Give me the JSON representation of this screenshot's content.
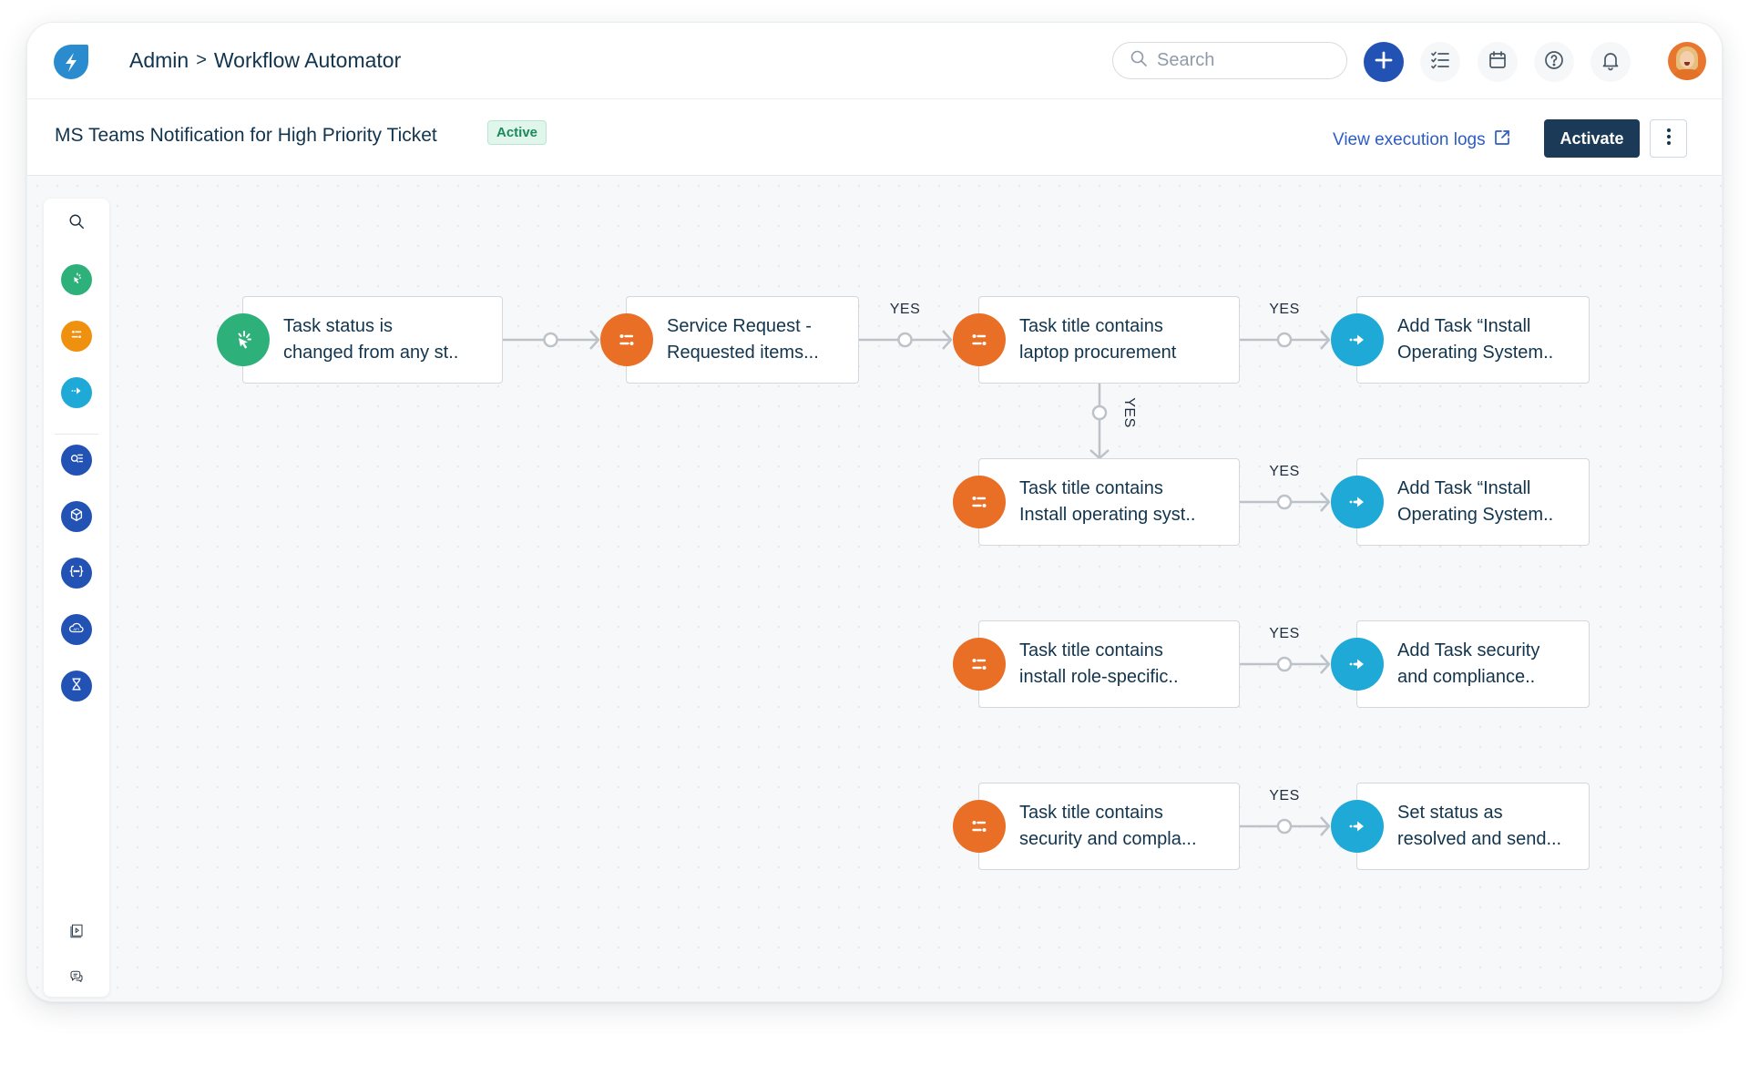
{
  "header": {
    "logo_icon": "lightning-bolt-icon",
    "breadcrumb": [
      "Admin",
      "Workflow Automator"
    ],
    "breadcrumb_separator": ">",
    "search": {
      "placeholder": "Search",
      "value": ""
    },
    "actions": [
      {
        "name": "new-item-button",
        "icon": "plus-icon"
      },
      {
        "name": "todo-button",
        "icon": "checklist-icon"
      },
      {
        "name": "calendar-button",
        "icon": "calendar-icon"
      },
      {
        "name": "help-button",
        "icon": "help-icon"
      },
      {
        "name": "notifications-button",
        "icon": "bell-icon"
      }
    ],
    "avatar": "user-avatar"
  },
  "workflow": {
    "title": "MS Teams Notification for High Priority Ticket",
    "status": "Active",
    "execution_logs_label": "View execution logs",
    "activate_label": "Activate"
  },
  "palette": {
    "top": [
      {
        "name": "search",
        "icon": "search-icon",
        "color": ""
      },
      {
        "name": "event",
        "icon": "cursor-click-icon",
        "color": "#2db07a"
      },
      {
        "name": "condition",
        "icon": "sliders-icon",
        "color": "#f0900f"
      },
      {
        "name": "action",
        "icon": "arrow-right-icon",
        "color": "#1ea9d6"
      }
    ],
    "middle": [
      {
        "name": "lookup",
        "icon": "search-list-icon",
        "color": "#2352b5"
      },
      {
        "name": "app",
        "icon": "cube-icon",
        "color": "#2352b5"
      },
      {
        "name": "json-parser",
        "icon": "braces-icon",
        "color": "#2352b5"
      },
      {
        "name": "web-request",
        "icon": "cloud-api-icon",
        "color": "#2352b5"
      },
      {
        "name": "timer",
        "icon": "hourglass-icon",
        "color": "#2352b5"
      }
    ],
    "bottom": [
      {
        "name": "tutorial",
        "icon": "video-book-icon"
      },
      {
        "name": "feedback",
        "icon": "chat-bubbles-icon"
      }
    ]
  },
  "flow": {
    "colors": {
      "trigger": "#2db07a",
      "condition": "#e86f25",
      "action": "#1ea9d6"
    },
    "edge_label": "YES",
    "nodes": [
      {
        "id": "n1",
        "type": "trigger",
        "text": [
          "Task status is",
          "changed from any st.."
        ]
      },
      {
        "id": "n2",
        "type": "condition",
        "text": [
          "Service Request -",
          "Requested items..."
        ]
      },
      {
        "id": "n3",
        "type": "condition",
        "text": [
          "Task title contains",
          "laptop procurement"
        ]
      },
      {
        "id": "n4",
        "type": "action",
        "text": [
          "Add Task “Install",
          "Operating System.."
        ]
      },
      {
        "id": "n5",
        "type": "condition",
        "text": [
          "Task title contains",
          "Install operating syst.."
        ]
      },
      {
        "id": "n6",
        "type": "action",
        "text": [
          "Add Task “Install",
          "Operating System.."
        ]
      },
      {
        "id": "n7",
        "type": "condition",
        "text": [
          "Task title contains",
          "install role-specific.."
        ]
      },
      {
        "id": "n8",
        "type": "action",
        "text": [
          "Add Task security",
          "and compliance.."
        ]
      },
      {
        "id": "n9",
        "type": "condition",
        "text": [
          "Task title contains",
          "security and compla..."
        ]
      },
      {
        "id": "n10",
        "type": "action",
        "text": [
          "Set status as",
          "resolved and send..."
        ]
      }
    ],
    "edges": [
      {
        "from": "n1",
        "to": "n2",
        "label": ""
      },
      {
        "from": "n2",
        "to": "n3",
        "label": "YES"
      },
      {
        "from": "n3",
        "to": "n4",
        "label": "YES"
      },
      {
        "from": "n3",
        "to": "n5",
        "label": "YES"
      },
      {
        "from": "n5",
        "to": "n6",
        "label": "YES"
      },
      {
        "from": "n7",
        "to": "n8",
        "label": "YES"
      },
      {
        "from": "n9",
        "to": "n10",
        "label": "YES"
      }
    ]
  }
}
